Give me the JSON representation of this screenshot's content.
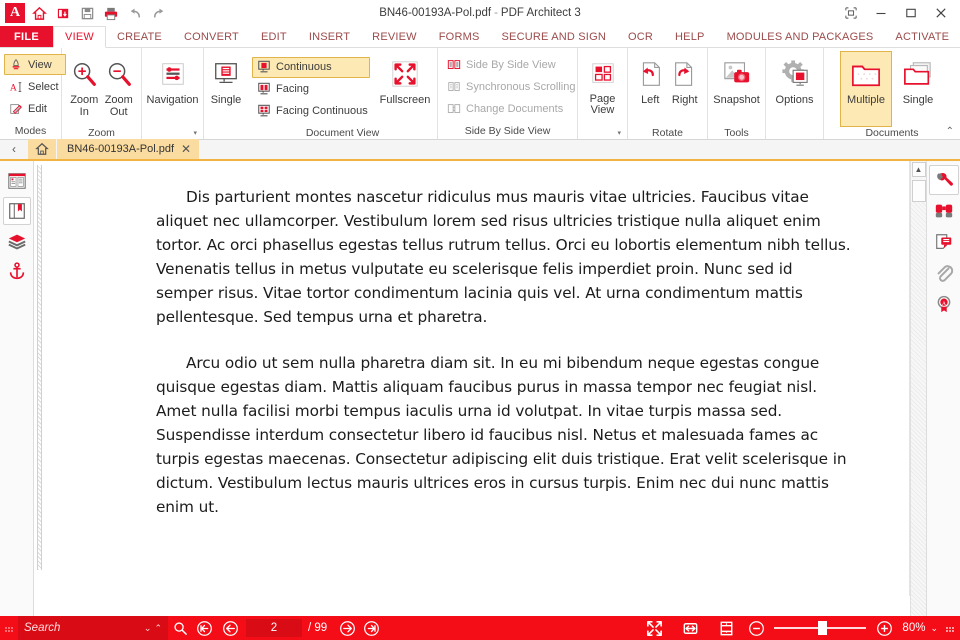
{
  "titlebar": {
    "logo": "A",
    "quick_access": [
      {
        "name": "home-icon",
        "label": "Home"
      },
      {
        "name": "open-document-icon",
        "label": "Open"
      },
      {
        "name": "save-icon",
        "label": "Save"
      },
      {
        "name": "print-icon",
        "label": "Print"
      },
      {
        "name": "undo-icon",
        "label": "Undo"
      },
      {
        "name": "redo-icon",
        "label": "Redo"
      }
    ],
    "document_name": "BN46-00193A-Pol.pdf",
    "separator": "-",
    "app_name": "PDF Architect 3",
    "window_controls": [
      {
        "name": "ribbon-display-options-icon",
        "label": "Ribbon Display Options"
      },
      {
        "name": "minimize-icon",
        "label": "Minimize"
      },
      {
        "name": "maximize-icon",
        "label": "Maximize"
      },
      {
        "name": "close-icon",
        "label": "Close"
      }
    ]
  },
  "ribbon_tabs": {
    "file": "FILE",
    "items": [
      {
        "label": "VIEW",
        "active": true
      },
      {
        "label": "CREATE",
        "active": false
      },
      {
        "label": "CONVERT",
        "active": false
      },
      {
        "label": "EDIT",
        "active": false
      },
      {
        "label": "INSERT",
        "active": false
      },
      {
        "label": "REVIEW",
        "active": false
      },
      {
        "label": "FORMS",
        "active": false
      },
      {
        "label": "SECURE AND SIGN",
        "active": false
      },
      {
        "label": "OCR",
        "active": false
      },
      {
        "label": "HELP",
        "active": false
      },
      {
        "label": "MODULES AND PACKAGES",
        "active": false
      },
      {
        "label": "ACTIVATE",
        "active": false
      }
    ]
  },
  "ribbon": {
    "groups": {
      "modes": {
        "label": "Modes",
        "items": [
          {
            "label": "View",
            "icon": "view-mode-icon",
            "selected": true
          },
          {
            "label": "Select",
            "icon": "select-text-icon",
            "selected": false
          },
          {
            "label": "Edit",
            "icon": "edit-pencil-icon",
            "selected": false
          }
        ]
      },
      "zoom": {
        "label": "Zoom",
        "items": [
          {
            "label": "Zoom In",
            "icon": "zoom-in-icon"
          },
          {
            "label": "Zoom Out",
            "icon": "zoom-out-icon"
          }
        ]
      },
      "navigation": {
        "label": "",
        "dropdown": "▾",
        "items": [
          {
            "label": "Navigation",
            "icon": "navigation-panel-icon"
          }
        ]
      },
      "document_view": {
        "label": "Document View",
        "single": {
          "label": "Single",
          "icon": "single-page-icon"
        },
        "items": [
          {
            "label": "Continuous",
            "icon": "continuous-view-icon",
            "selected": true
          },
          {
            "label": "Facing",
            "icon": "facing-view-icon",
            "selected": false
          },
          {
            "label": "Facing Continuous",
            "icon": "facing-continuous-icon",
            "selected": false
          }
        ],
        "fullscreen": {
          "label": "Fullscreen",
          "icon": "fullscreen-icon"
        }
      },
      "side_by_side": {
        "label": "Side By Side View",
        "items": [
          {
            "label": "Side By Side View",
            "icon": "side-by-side-icon",
            "disabled": true
          },
          {
            "label": "Synchronous Scrolling",
            "icon": "sync-scroll-icon",
            "disabled": true
          },
          {
            "label": "Change Documents",
            "icon": "change-documents-icon",
            "disabled": true
          }
        ]
      },
      "page_view": {
        "label": "",
        "dropdown": "▾",
        "items": [
          {
            "label": "Page\nView",
            "line1": "Page",
            "line2": "View",
            "icon": "page-view-icon"
          }
        ]
      },
      "rotate": {
        "label": "Rotate",
        "items": [
          {
            "label": "Left",
            "icon": "rotate-left-icon"
          },
          {
            "label": "Right",
            "icon": "rotate-right-icon"
          }
        ]
      },
      "tools": {
        "label": "Tools",
        "items": [
          {
            "label": "Snapshot",
            "icon": "snapshot-camera-icon"
          }
        ]
      },
      "options": {
        "label": "",
        "items": [
          {
            "label": "Options",
            "icon": "options-gear-icon"
          }
        ]
      },
      "documents": {
        "label": "Documents",
        "collapse": "⌃",
        "items": [
          {
            "label": "Multiple",
            "icon": "multiple-documents-icon",
            "selected": true
          },
          {
            "label": "Single",
            "icon": "single-document-icon",
            "selected": false
          }
        ]
      }
    }
  },
  "doctabs": {
    "scroll_left": "‹",
    "home_icon": "home-tab-icon",
    "tabs": [
      {
        "label": "BN46-00193A-Pol.pdf",
        "close": "✕",
        "active": true
      }
    ]
  },
  "leftbar": {
    "items": [
      {
        "name": "pages-thumbnails-icon",
        "label": "Page Thumbnails",
        "selected": false
      },
      {
        "name": "bookmarks-icon",
        "label": "Bookmarks",
        "selected": true
      },
      {
        "name": "layers-icon",
        "label": "Layers",
        "selected": false
      },
      {
        "name": "anchor-icon",
        "label": "Attachments",
        "selected": false
      }
    ]
  },
  "rightbar": {
    "items": [
      {
        "name": "tools-wrench-icon",
        "label": "Tools",
        "selected": true
      },
      {
        "name": "binoculars-search-icon",
        "label": "Search",
        "selected": false
      },
      {
        "name": "comment-icon",
        "label": "Comments",
        "selected": false
      },
      {
        "name": "paperclip-icon",
        "label": "Attachments",
        "selected": false
      },
      {
        "name": "signature-seal-icon",
        "label": "Signatures",
        "selected": false
      }
    ]
  },
  "document": {
    "paragraphs": [
      "Dis parturient montes nascetur ridiculus mus mauris vitae ultricies. Faucibus vitae aliquet nec ullamcorper. Vestibulum lorem sed risus ultricies tristique nulla aliquet enim tortor. Ac orci phasellus egestas tellus rutrum tellus. Orci eu lobortis elementum nibh tellus. Venenatis tellus in metus vulputate eu scelerisque felis imperdiet proin. Nunc sed id semper risus. Vitae tortor condimentum lacinia quis vel. At urna condimentum mattis pellentesque. Sed tempus urna et pharetra.",
      "Arcu odio ut sem nulla pharetra diam sit. In eu mi bibendum neque egestas congue quisque egestas diam. Mattis aliquam faucibus purus in massa tempor nec feugiat nisl. Amet nulla facilisi morbi tempus iaculis urna id volutpat. In vitae turpis massa sed. Suspendisse interdum consectetur libero id faucibus nisl. Netus et malesuada fames ac turpis egestas maecenas. Consectetur adipiscing elit duis tristique. Erat velit scelerisque in dictum. Vestibulum lectus mauris ultrices eros in cursus turpis. Enim nec dui nunc mattis enim ut."
    ]
  },
  "statusbar": {
    "search_placeholder": "Search",
    "search_value": "",
    "search_down": "⌄",
    "search_up": "⌃",
    "search_icon": "search-magnifier-icon",
    "nav": [
      {
        "name": "first-page-button",
        "label": "First Page"
      },
      {
        "name": "previous-page-button",
        "label": "Previous Page"
      }
    ],
    "current_page": "2",
    "page_total": "/ 99",
    "nav_forward": [
      {
        "name": "next-page-button",
        "label": "Next Page"
      },
      {
        "name": "last-page-button",
        "label": "Last Page"
      }
    ],
    "view_tools": [
      {
        "name": "fullscreen-button",
        "label": "Fullscreen"
      },
      {
        "name": "fit-width-button",
        "label": "Fit Width"
      },
      {
        "name": "fit-page-button",
        "label": "Fit Page"
      }
    ],
    "zoom_out": "zoom-out-button",
    "zoom_in": "zoom-in-button",
    "zoom_value": "80%",
    "zoom_dropdown": "⌄",
    "resize_grip": "resize-grip-icon"
  },
  "colors": {
    "brand_red": "#e8112d",
    "status_red": "#f40d17",
    "highlight_yellow": "#fde9b4",
    "tab_orange": "#fbdca0"
  }
}
